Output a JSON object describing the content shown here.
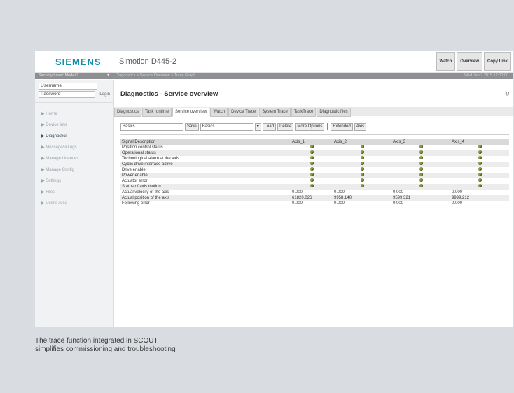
{
  "app": {
    "brand": "SIEMENS",
    "title": "Simotion D445-2",
    "top_buttons": [
      "Watch",
      "Overview",
      "Copy Link"
    ]
  },
  "statusbar": {
    "security": "Security Level: Mode#1",
    "arrow": "▼",
    "breadcrumb": "Diagnostics > Service Overview > Trace Graph",
    "datetime": "Wed Jan 7 2015 12:00:00"
  },
  "login": {
    "username_label": "Username",
    "password_label": "Password",
    "login_button": "Login"
  },
  "sidebar": {
    "items": [
      {
        "label": "▶ Home"
      },
      {
        "label": "▶ Device Info"
      },
      {
        "label": "▶ Diagnostics"
      },
      {
        "label": "▶ Messages&Logs"
      },
      {
        "label": "▶ Manage Licences"
      },
      {
        "label": "▶ Manage Config"
      },
      {
        "label": "▶ Settings"
      },
      {
        "label": "▶ Files"
      },
      {
        "label": "▶ User's Area"
      }
    ]
  },
  "page": {
    "title": "Diagnostics - Service overview",
    "refresh_icon": "↻"
  },
  "tabs": [
    "Diagnostics",
    "Task runtime",
    "Service overview",
    "Watch",
    "Device Trace",
    "System Trace",
    "TaskTrace",
    "Diagnostic files"
  ],
  "toolbar": {
    "template_value": "Basics",
    "save": "Save",
    "select_value": "Basics",
    "dropdown_icon": "▾",
    "load": "Load",
    "delete": "Delete",
    "more_options": "More Options",
    "extended": "Extended",
    "axis": "Axis"
  },
  "table": {
    "columns": [
      "Signal Description",
      "Axis_1",
      "Axis_2",
      "Axis_3",
      "Axis_4"
    ],
    "status_rows": [
      "Position control status",
      "Operational status",
      "Technological alarm at the axis",
      "Cyclic drive interface active",
      "Drive enable",
      "Power enable",
      "Actuator error",
      "Status of axis motion"
    ],
    "value_rows": [
      {
        "label": "Actual velocity of the axis",
        "values": [
          "0.000",
          "0.000",
          "0.000",
          "0.000"
        ]
      },
      {
        "label": "Actual position of the axis",
        "values": [
          "61820.026",
          "9958.140",
          "9599.321",
          "9999.212"
        ]
      },
      {
        "label": "Following error",
        "values": [
          "0.000",
          "0.000",
          "0.000",
          "0.000"
        ]
      }
    ]
  },
  "caption": {
    "line1": "The trace function integrated in SCOUT",
    "line2": "simplifies commissioning and troubleshooting"
  },
  "colors": {
    "brand": "#0f8fa8",
    "statusbar": "#8d8f92",
    "status_ok": "#8a9a40",
    "background": "#d9dde2"
  }
}
